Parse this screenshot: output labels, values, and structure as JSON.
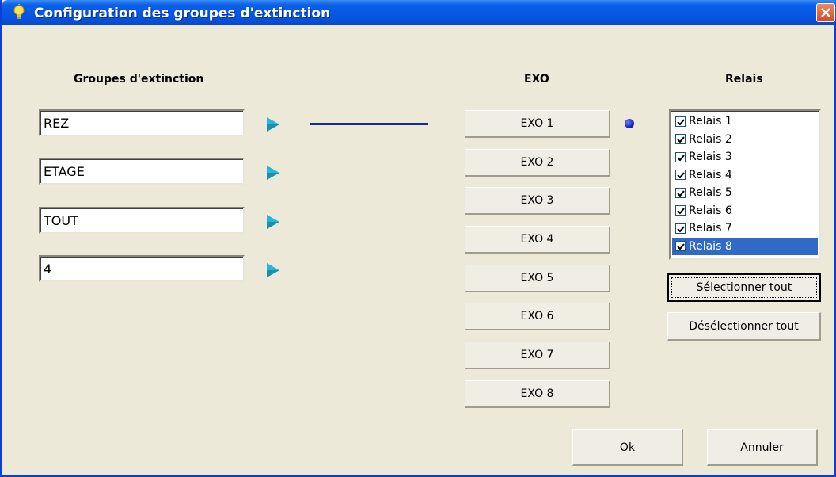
{
  "window": {
    "title": "Configuration des groupes d'extinction",
    "title_bar_color": "#0654e2",
    "close_icon": "close-icon"
  },
  "headers": {
    "groups": "Groupes d'extinction",
    "exo": "EXO",
    "relays": "Relais"
  },
  "groups": [
    {
      "value": "REZ"
    },
    {
      "value": "ETAGE"
    },
    {
      "value": "TOUT"
    },
    {
      "value": "4"
    }
  ],
  "exo_buttons": [
    {
      "label": "EXO 1"
    },
    {
      "label": "EXO 2"
    },
    {
      "label": "EXO 3"
    },
    {
      "label": "EXO 4"
    },
    {
      "label": "EXO 5"
    },
    {
      "label": "EXO 6"
    },
    {
      "label": "EXO 7"
    },
    {
      "label": "EXO 8"
    }
  ],
  "relays": [
    {
      "label": "Relais 1",
      "checked": true
    },
    {
      "label": "Relais 2",
      "checked": true
    },
    {
      "label": "Relais 3",
      "checked": true
    },
    {
      "label": "Relais 4",
      "checked": true
    },
    {
      "label": "Relais 5",
      "checked": true
    },
    {
      "label": "Relais 6",
      "checked": true
    },
    {
      "label": "Relais 7",
      "checked": true
    },
    {
      "label": "Relais 8",
      "checked": true,
      "selected": true
    }
  ],
  "actions": {
    "select_all": "Sélectionner tout",
    "deselect_all": "Désélectionner tout",
    "ok": "Ok",
    "cancel": "Annuler"
  },
  "colors": {
    "window_bg": "#ece9d8",
    "arrow": "#27b6d8",
    "link_line": "#1b2a8f",
    "indicator_dot": "#0b1aa8",
    "selection": "#316ac5"
  }
}
